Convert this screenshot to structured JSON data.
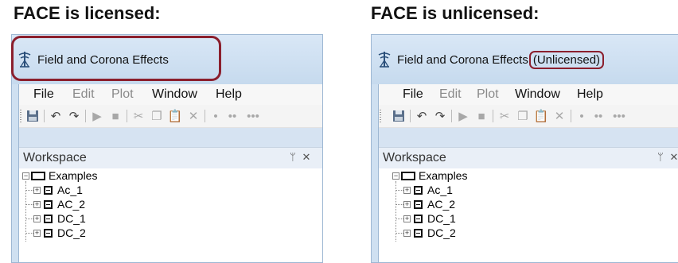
{
  "headings": {
    "left": "FACE is licensed:",
    "right": "FACE is unlicensed:"
  },
  "panels": [
    {
      "title": "Field and Corona Effects",
      "title_suffix": ""
    },
    {
      "title": "Field and Corona Effects",
      "title_suffix": "(Unlicensed)"
    }
  ],
  "menu": [
    {
      "label": "File",
      "enabled": true
    },
    {
      "label": "Edit",
      "enabled": false
    },
    {
      "label": "Plot",
      "enabled": false
    },
    {
      "label": "Window",
      "enabled": true
    },
    {
      "label": "Help",
      "enabled": true
    }
  ],
  "toolbar_icons": [
    "save-icon",
    "undo-icon",
    "redo-icon",
    "play-icon",
    "stop-icon",
    "cut-icon",
    "copy-icon",
    "paste-icon",
    "delete-icon",
    "dot-icon",
    "dots-icon",
    "more-icon"
  ],
  "workspace": {
    "title": "Workspace",
    "pin_glyph": "ᛘ",
    "close_glyph": "✕"
  },
  "tree": {
    "root": "Examples",
    "items": [
      "Ac_1",
      "AC_2",
      "DC_1",
      "DC_2"
    ]
  },
  "colors": {
    "highlight": "#8b1f2d",
    "titlebar": "#cfe0f1"
  }
}
